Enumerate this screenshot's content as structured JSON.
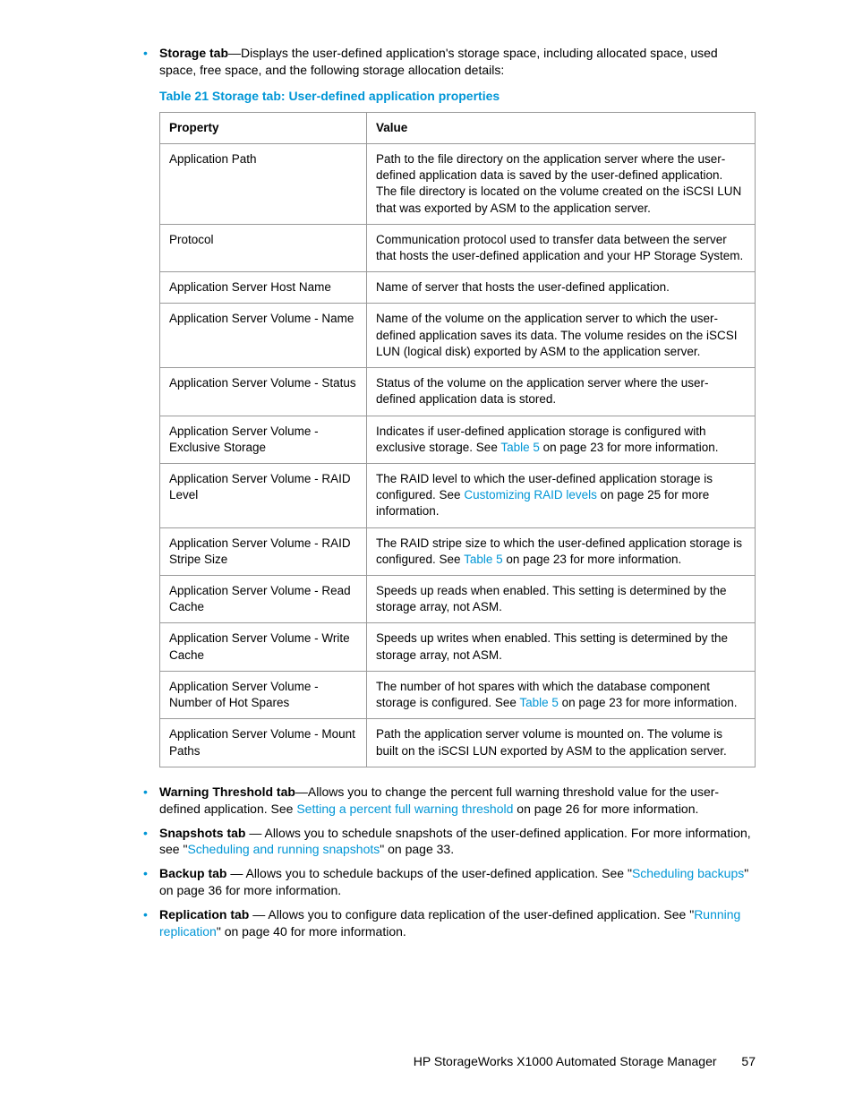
{
  "intro_bullet": {
    "label": "Storage tab",
    "text": "—Displays the user-defined application's storage space, including allocated space, used space, free space, and the following storage allocation details:"
  },
  "table_title": "Table 21 Storage tab: User-defined application properties",
  "table": {
    "headers": {
      "property": "Property",
      "value": "Value"
    },
    "rows": [
      {
        "property": "Application Path",
        "value": "Path to the file directory on the application server where the user-defined application data is saved by the user-defined application. The file directory is located on the volume created on the iSCSI LUN that was exported by ASM to the application server."
      },
      {
        "property": "Protocol",
        "value": "Communication protocol used to transfer data between the server that hosts the user-defined application and your HP Storage System."
      },
      {
        "property": "Application Server Host Name",
        "value": "Name of server that hosts the user-defined application."
      },
      {
        "property": "Application Server Volume - Name",
        "value": "Name of the volume on the application server to which the user-defined application saves its data. The volume resides on the iSCSI LUN (logical disk) exported by ASM to the application server."
      },
      {
        "property": "Application Server Volume - Status",
        "value": "Status of the volume on the application server where the user-defined application data is stored."
      },
      {
        "property": "Application Server Volume - Exclusive Storage",
        "value_pre": "Indicates if user-defined application storage is configured with exclusive storage. See ",
        "link": "Table 5",
        "value_post": " on page 23 for more information."
      },
      {
        "property": "Application Server Volume - RAID Level",
        "value_pre": "The RAID level to which the user-defined application storage is configured. See ",
        "link": "Customizing RAID levels",
        "value_post": " on page 25 for more information."
      },
      {
        "property": "Application Server Volume - RAID Stripe Size",
        "value_pre": "The RAID stripe size to which the user-defined application storage is configured. See ",
        "link": "Table 5",
        "value_post": " on page 23 for more information."
      },
      {
        "property": "Application Server Volume - Read Cache",
        "value": "Speeds up reads when enabled. This setting is determined by the storage array, not ASM."
      },
      {
        "property": "Application Server Volume - Write Cache",
        "value": "Speeds up writes when enabled. This setting is determined by the storage array, not ASM."
      },
      {
        "property": "Application Server Volume - Number of Hot Spares",
        "value_pre": "The number of hot spares with which the database component storage is configured. See ",
        "link": "Table 5",
        "value_post": " on page 23 for more information."
      },
      {
        "property": "Application Server Volume - Mount Paths",
        "value": "Path the application server volume is mounted on. The volume is built on the iSCSI LUN exported by ASM to the application server."
      }
    ]
  },
  "bottom_bullets": [
    {
      "label": "Warning Threshold tab",
      "pre": "—Allows you to change the percent full warning threshold value for the user-defined application. See ",
      "link": "Setting a percent full warning threshold",
      "post": " on page 26 for more information."
    },
    {
      "label": "Snapshots tab",
      "pre": " — Allows you to schedule snapshots of the user-defined application. For more information, see \"",
      "link": "Scheduling and running snapshots",
      "post": "\" on page 33."
    },
    {
      "label": "Backup tab",
      "pre": " — Allows you to schedule backups of the user-defined application. See \"",
      "link": "Scheduling backups",
      "post": "\" on page 36 for more information."
    },
    {
      "label": "Replication tab",
      "pre": " — Allows you to configure data replication of the user-defined application. See \"",
      "link": "Running replication",
      "post": "\" on page 40 for more information."
    }
  ],
  "footer": {
    "text": "HP StorageWorks X1000 Automated Storage Manager",
    "page": "57"
  }
}
